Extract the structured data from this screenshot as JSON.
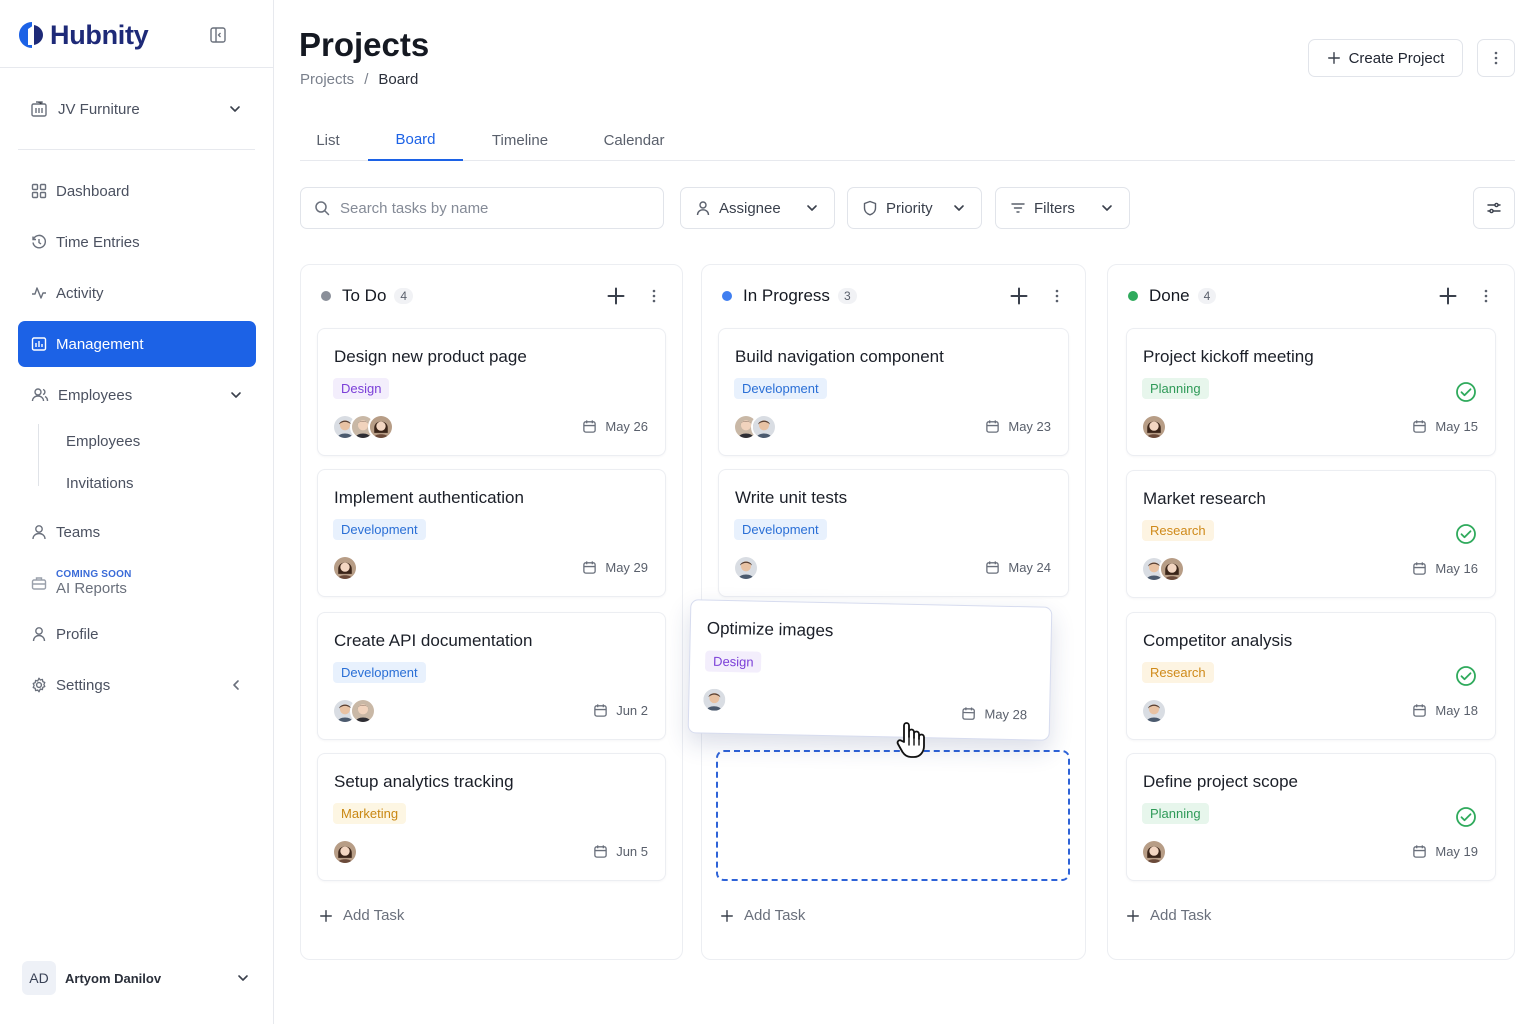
{
  "app": {
    "name": "Hubnity"
  },
  "sidebar": {
    "org": "JV Furniture",
    "items": [
      {
        "label": "Dashboard"
      },
      {
        "label": "Time Entries"
      },
      {
        "label": "Activity"
      },
      {
        "label": "Management"
      },
      {
        "label": "Employees"
      },
      {
        "label": "Teams"
      },
      {
        "label": "AI Reports",
        "badge": "COMING SOON"
      },
      {
        "label": "Profile"
      },
      {
        "label": "Settings"
      }
    ],
    "sub_items": [
      {
        "label": "Employees"
      },
      {
        "label": "Invitations"
      }
    ],
    "user": {
      "initials": "AD",
      "name": "Artyom Danilov"
    }
  },
  "header": {
    "title": "Projects",
    "breadcrumb": [
      "Projects",
      "/",
      "Board"
    ],
    "create_label": "Create Project"
  },
  "tabs": [
    {
      "label": "List"
    },
    {
      "label": "Board"
    },
    {
      "label": "Timeline"
    },
    {
      "label": "Calendar"
    }
  ],
  "toolbar": {
    "search_placeholder": "Search tasks by name",
    "assignee": "Assignee",
    "priority": "Priority",
    "filters": "Filters"
  },
  "colors": {
    "accent": "#1c62e6",
    "todo": "#8a8f99",
    "in_progress": "#3f7ef0",
    "done": "#2faa5c"
  },
  "columns": [
    {
      "title": "To Do",
      "count": "4",
      "add_task": "Add Task",
      "cards": [
        {
          "title": "Design new product page",
          "tag": "Design",
          "date": "May 26"
        },
        {
          "title": "Implement authentication",
          "tag": "Development",
          "date": "May 29"
        },
        {
          "title": "Create API documentation",
          "tag": "Development",
          "date": "Jun 2"
        },
        {
          "title": "Setup analytics tracking",
          "tag": "Marketing",
          "date": "Jun 5"
        }
      ]
    },
    {
      "title": "In Progress",
      "count": "3",
      "add_task": "Add Task",
      "cards": [
        {
          "title": "Build navigation component",
          "tag": "Development",
          "date": "May 23"
        },
        {
          "title": "Write unit tests",
          "tag": "Development",
          "date": "May 24"
        },
        {
          "title": "Optimize images",
          "tag": "Design",
          "date": "May 28"
        }
      ]
    },
    {
      "title": "Done",
      "count": "4",
      "add_task": "Add Task",
      "cards": [
        {
          "title": "Project kickoff meeting",
          "tag": "Planning",
          "date": "May 15"
        },
        {
          "title": "Market research",
          "tag": "Research",
          "date": "May 16"
        },
        {
          "title": "Competitor analysis",
          "tag": "Research",
          "date": "May 18"
        },
        {
          "title": "Define project scope",
          "tag": "Planning",
          "date": "May 19"
        }
      ]
    }
  ]
}
